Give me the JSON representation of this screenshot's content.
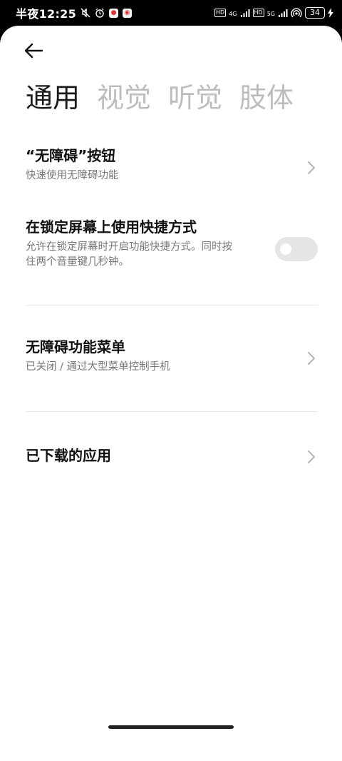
{
  "status_bar": {
    "time": "半夜12:25",
    "network_1": "4G",
    "network_2": "5G",
    "hd_label": "HD",
    "battery": "34"
  },
  "tabs": [
    {
      "label": "通用",
      "active": true
    },
    {
      "label": "视觉",
      "active": false
    },
    {
      "label": "听觉",
      "active": false
    },
    {
      "label": "肢体",
      "active": false
    }
  ],
  "items": {
    "accessibility_button": {
      "title": "“无障碍”按钮",
      "subtitle": "快速使用无障碍功能"
    },
    "lock_screen_shortcut": {
      "title": "在锁定屏幕上使用快捷方式",
      "subtitle_line1": "允许在锁定屏幕时开启功能快捷方式。同时按",
      "subtitle_line2": "住两个音量键几秒钟。",
      "enabled": false
    },
    "accessibility_menu": {
      "title": "无障碍功能菜单",
      "subtitle": "已关闭 / 通过大型菜单控制手机"
    },
    "downloaded_apps": {
      "title": "已下载的应用"
    }
  }
}
